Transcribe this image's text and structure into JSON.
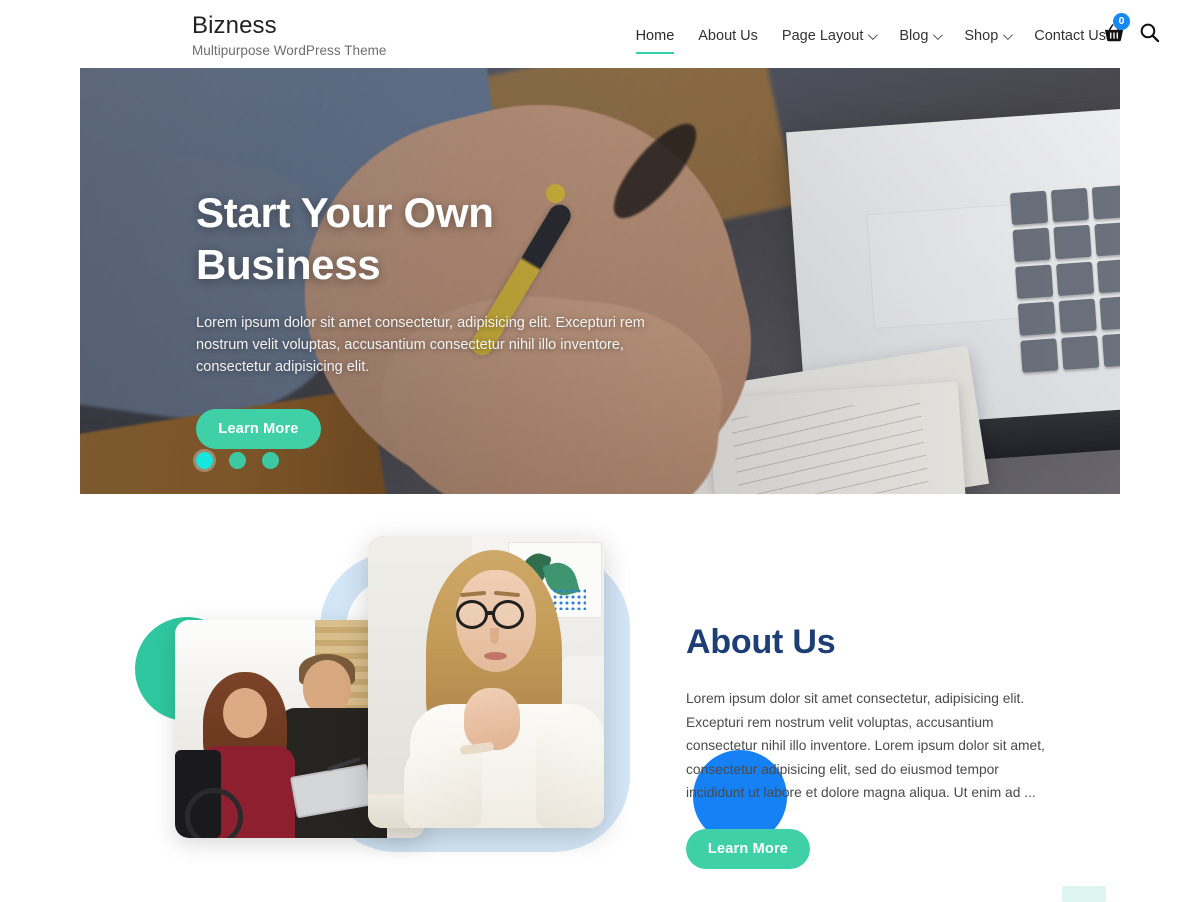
{
  "header": {
    "brand_title": "Bizness",
    "brand_tagline": "Multipurpose WordPress Theme",
    "nav": [
      {
        "label": "Home",
        "has_dropdown": false,
        "active": true
      },
      {
        "label": "About Us",
        "has_dropdown": false,
        "active": false
      },
      {
        "label": "Page Layout",
        "has_dropdown": true,
        "active": false
      },
      {
        "label": "Blog",
        "has_dropdown": true,
        "active": false
      },
      {
        "label": "Shop",
        "has_dropdown": true,
        "active": false
      },
      {
        "label": "Contact Us",
        "has_dropdown": false,
        "active": false
      }
    ],
    "cart_icon": "shopping-basket-icon",
    "cart_count": "0",
    "search_icon": "search-icon"
  },
  "hero": {
    "title": "Start Your Own Business",
    "description": "Lorem ipsum dolor sit amet consectetur, adipisicing elit. Excepturi rem nostrum velit voluptas, accusantium consectetur nihil illo inventore, consectetur adipisicing elit.",
    "button_label": "Learn More",
    "slides": [
      {
        "index": "1",
        "active": true
      },
      {
        "index": "2",
        "active": false
      },
      {
        "index": "3",
        "active": false
      }
    ]
  },
  "about": {
    "title": "About Us",
    "body": "Lorem ipsum dolor sit amet consectetur, adipisicing elit. Excepturi rem nostrum velit voluptas, accusantium consectetur nihil illo inventore. Lorem ipsum dolor sit amet, consectetur adipisicing elit, sed do eiusmod tempor incididunt ut labore et dolore magna aliqua. Ut enim ad ...",
    "button_label": "Learn More",
    "images": [
      {
        "name": "team-meeting-photo"
      },
      {
        "name": "businesswoman-portrait-photo"
      }
    ]
  },
  "colors": {
    "accent_teal": "#3fd0a7",
    "accent_cyan": "#16e6de",
    "brand_navy": "#1e3f75",
    "badge_blue": "#1789f0",
    "deco_teal": "#2fc79f",
    "deco_blue": "#1681f4",
    "deco_light_blue": "#d3e6f6"
  }
}
